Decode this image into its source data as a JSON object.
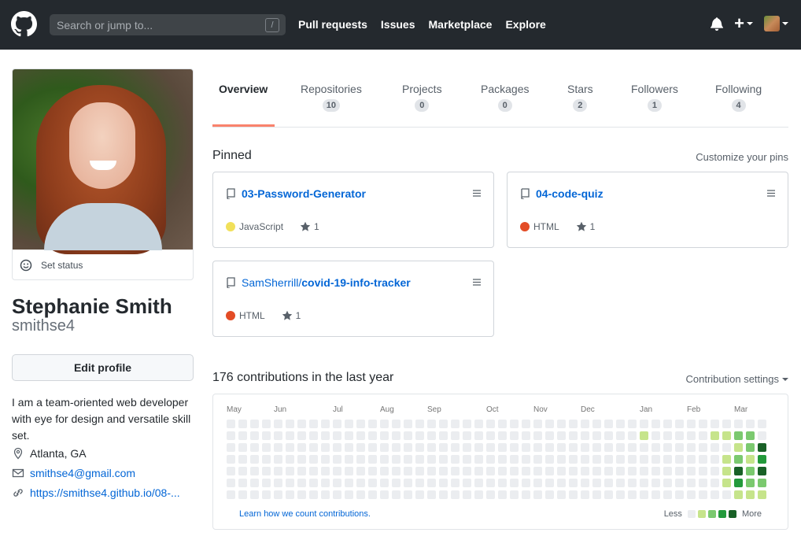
{
  "header": {
    "search_placeholder": "Search or jump to...",
    "search_shortcut": "/",
    "nav": [
      "Pull requests",
      "Issues",
      "Marketplace",
      "Explore"
    ],
    "icons": [
      "github-logo-icon",
      "bell-icon",
      "plus-icon",
      "avatar"
    ]
  },
  "profile": {
    "set_status": "Set status",
    "name": "Stephanie Smith",
    "login": "smithse4",
    "edit_profile": "Edit profile",
    "bio": "I am a team-oriented web developer with eye for design and versatile skill set.",
    "location": "Atlanta, GA",
    "email": "smithse4@gmail.com",
    "website": "https://smithse4.github.io/08-..."
  },
  "tabs": [
    {
      "label": "Overview",
      "count": ""
    },
    {
      "label": "Repositories",
      "count": "10"
    },
    {
      "label": "Projects",
      "count": "0"
    },
    {
      "label": "Packages",
      "count": "0"
    },
    {
      "label": "Stars",
      "count": "2"
    },
    {
      "label": "Followers",
      "count": "1"
    },
    {
      "label": "Following",
      "count": "4"
    }
  ],
  "pinned": {
    "title": "Pinned",
    "customize": "Customize your pins",
    "repos": [
      {
        "owner": "",
        "name": "03-Password-Generator",
        "language": "JavaScript",
        "lang_color": "#f1e05a",
        "stars": "1"
      },
      {
        "owner": "",
        "name": "04-code-quiz",
        "language": "HTML",
        "lang_color": "#e34c26",
        "stars": "1"
      },
      {
        "owner": "SamSherrill/",
        "name": "covid-19-info-tracker",
        "language": "HTML",
        "lang_color": "#e34c26",
        "stars": "1"
      }
    ]
  },
  "contributions": {
    "title": "176 contributions in the last year",
    "settings": "Contribution settings",
    "months": [
      "May",
      "Jun",
      "Jul",
      "Aug",
      "Sep",
      "Oct",
      "Nov",
      "Dec",
      "Jan",
      "Feb",
      "Mar"
    ],
    "learn": "Learn how we count contributions.",
    "less": "Less",
    "more": "More",
    "colors": [
      "#ebedf0",
      "#c6e48b",
      "#7bc96f",
      "#239a3b",
      "#196127"
    ]
  }
}
